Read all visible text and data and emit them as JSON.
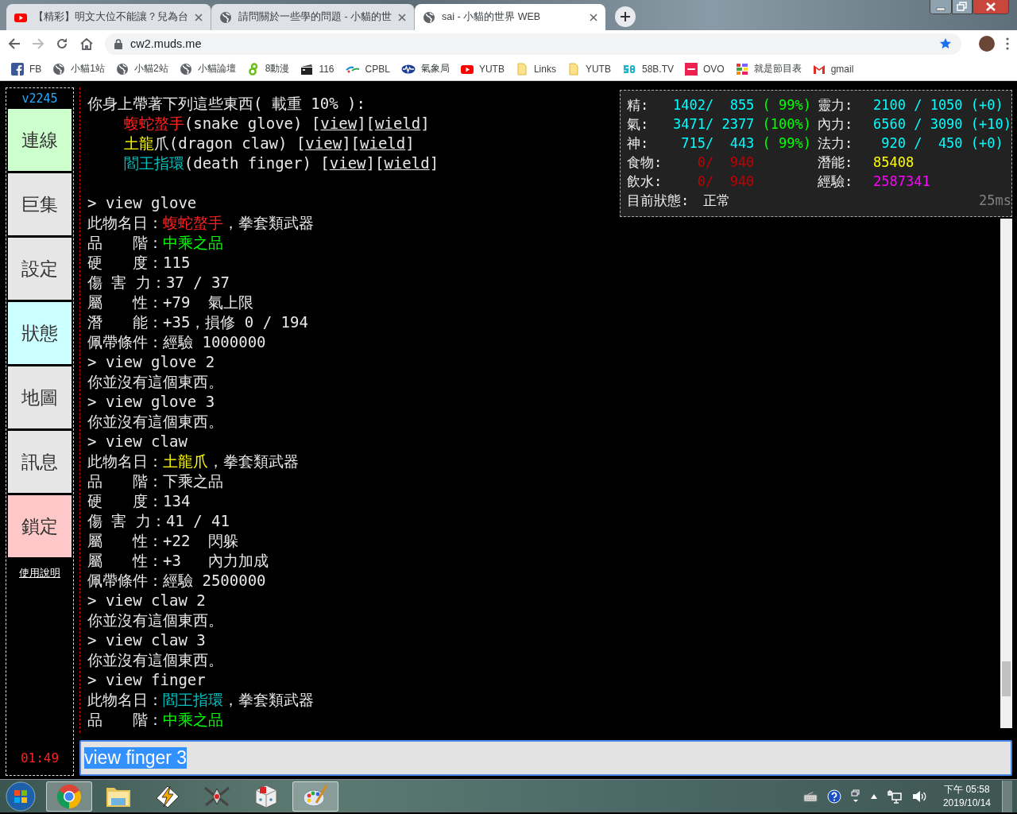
{
  "browser": {
    "tabs": [
      {
        "title": "【精彩】明文大位不能讓？兒為台",
        "kind": "youtube",
        "selected": false
      },
      {
        "title": "請問關於一些學的問題 - 小貓的世",
        "kind": "globe",
        "selected": false
      },
      {
        "title": "sai - 小貓的世界 WEB",
        "kind": "globe",
        "selected": true
      }
    ],
    "address": "cw2.muds.me",
    "bookmarked": true,
    "bookmarks": [
      {
        "label": "FB",
        "kind": "facebook"
      },
      {
        "label": "小貓1站",
        "kind": "globe"
      },
      {
        "label": "小貓2站",
        "kind": "globe"
      },
      {
        "label": "小貓論壇",
        "kind": "globe"
      },
      {
        "label": "8動漫",
        "kind": "eight"
      },
      {
        "label": "116",
        "kind": "clapper"
      },
      {
        "label": "CPBL",
        "kind": "cpbl"
      },
      {
        "label": "氣象局",
        "kind": "weather"
      },
      {
        "label": "YUTB",
        "kind": "youtube"
      },
      {
        "label": "Links",
        "kind": "folder"
      },
      {
        "label": "YUTB",
        "kind": "folder"
      },
      {
        "label": "58B.TV",
        "kind": "fiftyeight"
      },
      {
        "label": "OVO",
        "kind": "ovo"
      },
      {
        "label": "就是節目表",
        "kind": "grid"
      },
      {
        "label": "gmail",
        "kind": "gmail"
      }
    ]
  },
  "sidebar": {
    "version": "v2245",
    "buttons": [
      {
        "label": "連線",
        "color": "#ccffcc"
      },
      {
        "label": "巨集",
        "color": "#e6e6e6"
      },
      {
        "label": "設定",
        "color": "#e6e6e6"
      },
      {
        "label": "狀態",
        "color": "#ccffff"
      },
      {
        "label": "地圖",
        "color": "#e6e6e6"
      },
      {
        "label": "訊息",
        "color": "#e6e6e6"
      },
      {
        "label": "鎖定",
        "color": "#ffc8c8"
      }
    ],
    "help_link": "使用說明",
    "timer": "01:49"
  },
  "terminal": {
    "lines": [
      {
        "kind": "text",
        "segments": [
          {
            "text": "你身上帶著下列這些東西( 載重 10% ):"
          }
        ]
      },
      {
        "kind": "text",
        "segments": [
          {
            "text": "    蝮蛇螯手",
            "color": "#ff2020"
          },
          {
            "text": "(snake glove) ["
          },
          {
            "text": "view",
            "kind": "link"
          },
          {
            "text": "]["
          },
          {
            "text": "wield",
            "kind": "link"
          },
          {
            "text": "]"
          }
        ]
      },
      {
        "kind": "text",
        "segments": [
          {
            "text": "    土龍",
            "color": "#ffff00"
          },
          {
            "text": "爪(dragon claw) ["
          },
          {
            "text": "view",
            "kind": "link"
          },
          {
            "text": "]["
          },
          {
            "text": "wield",
            "kind": "link"
          },
          {
            "text": "]"
          }
        ]
      },
      {
        "kind": "text",
        "segments": [
          {
            "text": "    閻王指環",
            "color": "#00c0c0"
          },
          {
            "text": "(death finger) ["
          },
          {
            "text": "view",
            "kind": "link"
          },
          {
            "text": "]["
          },
          {
            "text": "wield",
            "kind": "link"
          },
          {
            "text": "]"
          }
        ]
      },
      {
        "kind": "blank"
      },
      {
        "kind": "text",
        "segments": [
          {
            "text": "> view glove"
          }
        ]
      },
      {
        "kind": "text",
        "segments": [
          {
            "text": "此物名日："
          },
          {
            "text": "蝮蛇螯手",
            "color": "#ff2020"
          },
          {
            "text": "，拳套類武器"
          }
        ]
      },
      {
        "kind": "text",
        "segments": [
          {
            "text": "品　　階："
          },
          {
            "text": "中乘之品",
            "color": "#00ff00"
          }
        ]
      },
      {
        "kind": "text",
        "segments": [
          {
            "text": "硬　　度：115"
          }
        ]
      },
      {
        "kind": "text",
        "segments": [
          {
            "text": "傷 害 力：37 / 37"
          }
        ]
      },
      {
        "kind": "text",
        "segments": [
          {
            "text": "屬　　性：+79  氣上限"
          }
        ]
      },
      {
        "kind": "text",
        "segments": [
          {
            "text": "潛　　能：+35，損修 0 / 194"
          }
        ]
      },
      {
        "kind": "text",
        "segments": [
          {
            "text": "佩帶條件：經驗 1000000"
          }
        ]
      },
      {
        "kind": "text",
        "segments": [
          {
            "text": "> view glove 2"
          }
        ]
      },
      {
        "kind": "text",
        "segments": [
          {
            "text": "你並沒有這個東西。"
          }
        ]
      },
      {
        "kind": "text",
        "segments": [
          {
            "text": "> view glove 3"
          }
        ]
      },
      {
        "kind": "text",
        "segments": [
          {
            "text": "你並沒有這個東西。"
          }
        ]
      },
      {
        "kind": "text",
        "segments": [
          {
            "text": "> view claw"
          }
        ]
      },
      {
        "kind": "text",
        "segments": [
          {
            "text": "此物名日："
          },
          {
            "text": "土龍爪",
            "color": "#ffff00"
          },
          {
            "text": "，拳套類武器"
          }
        ]
      },
      {
        "kind": "text",
        "segments": [
          {
            "text": "品　　階：下乘之品"
          }
        ]
      },
      {
        "kind": "text",
        "segments": [
          {
            "text": "硬　　度：134"
          }
        ]
      },
      {
        "kind": "text",
        "segments": [
          {
            "text": "傷 害 力：41 / 41"
          }
        ]
      },
      {
        "kind": "text",
        "segments": [
          {
            "text": "屬　　性：+22  閃躲"
          }
        ]
      },
      {
        "kind": "text",
        "segments": [
          {
            "text": "屬　　性：+3   內力加成"
          }
        ]
      },
      {
        "kind": "text",
        "segments": [
          {
            "text": "佩帶條件：經驗 2500000"
          }
        ]
      },
      {
        "kind": "text",
        "segments": [
          {
            "text": "> view claw 2"
          }
        ]
      },
      {
        "kind": "text",
        "segments": [
          {
            "text": "你並沒有這個東西。"
          }
        ]
      },
      {
        "kind": "text",
        "segments": [
          {
            "text": "> view claw 3"
          }
        ]
      },
      {
        "kind": "text",
        "segments": [
          {
            "text": "你並沒有這個東西。"
          }
        ]
      },
      {
        "kind": "text",
        "segments": [
          {
            "text": "> view finger"
          }
        ]
      },
      {
        "kind": "text",
        "segments": [
          {
            "text": "此物名日："
          },
          {
            "text": "閻王指環",
            "color": "#00c0c0"
          },
          {
            "text": "，拳套類武器"
          }
        ]
      },
      {
        "kind": "text",
        "segments": [
          {
            "text": "品　　階："
          },
          {
            "text": "中乘之品",
            "color": "#00ff00"
          }
        ]
      }
    ]
  },
  "status": {
    "stats": [
      {
        "label": "精:",
        "segments": [
          {
            "text": "1402/  855 ",
            "color": "#00ffff"
          },
          {
            "text": "( 99%)",
            "color": "#00ff00"
          }
        ]
      },
      {
        "label": "靈力:",
        "segments": [
          {
            "text": "2100 / 1050 (+0)",
            "color": "#00ffff"
          }
        ]
      },
      {
        "label": "氣:",
        "segments": [
          {
            "text": "3471/ 2377 ",
            "color": "#00ffff"
          },
          {
            "text": "(100%)",
            "color": "#00ff00"
          }
        ]
      },
      {
        "label": "內力:",
        "segments": [
          {
            "text": "6560 / 3090 (+10)",
            "color": "#00ffff"
          }
        ]
      },
      {
        "label": "神:",
        "segments": [
          {
            "text": " 715/  443 ",
            "color": "#00ffff"
          },
          {
            "text": "( 99%)",
            "color": "#00ff00"
          }
        ]
      },
      {
        "label": "法力:",
        "segments": [
          {
            "text": " 920 /  450 (+0)",
            "color": "#00ffff"
          }
        ]
      },
      {
        "label": "食物:",
        "segments": [
          {
            "text": "   0/  940",
            "color": "#c00000"
          }
        ]
      },
      {
        "label": "潛能:",
        "segments": [
          {
            "text": "85408",
            "color": "#ffff00"
          }
        ]
      },
      {
        "label": "飲水:",
        "segments": [
          {
            "text": "   0/  940",
            "color": "#c00000"
          }
        ]
      },
      {
        "label": "經驗:",
        "segments": [
          {
            "text": "2587341",
            "color": "#ff00ff"
          }
        ]
      }
    ],
    "state_label": "目前狀態:",
    "state": "正常",
    "latency": "25ms"
  },
  "command_input": {
    "value": "view finger 3",
    "text_selected": true
  },
  "taskbar": {
    "apps": [
      {
        "kind": "browser",
        "active": true
      },
      {
        "kind": "folder",
        "active": false
      },
      {
        "kind": "bolt",
        "active": false
      },
      {
        "kind": "ship",
        "active": false
      },
      {
        "kind": "dice",
        "active": false
      },
      {
        "kind": "palette",
        "active": true
      }
    ],
    "tray": [
      {
        "kind": "keyboard"
      },
      {
        "kind": "help"
      },
      {
        "kind": "windows"
      },
      {
        "kind": "arrow"
      },
      {
        "kind": "network"
      },
      {
        "kind": "speaker"
      }
    ],
    "time": "下午 05:58",
    "date": "2019/10/14"
  }
}
